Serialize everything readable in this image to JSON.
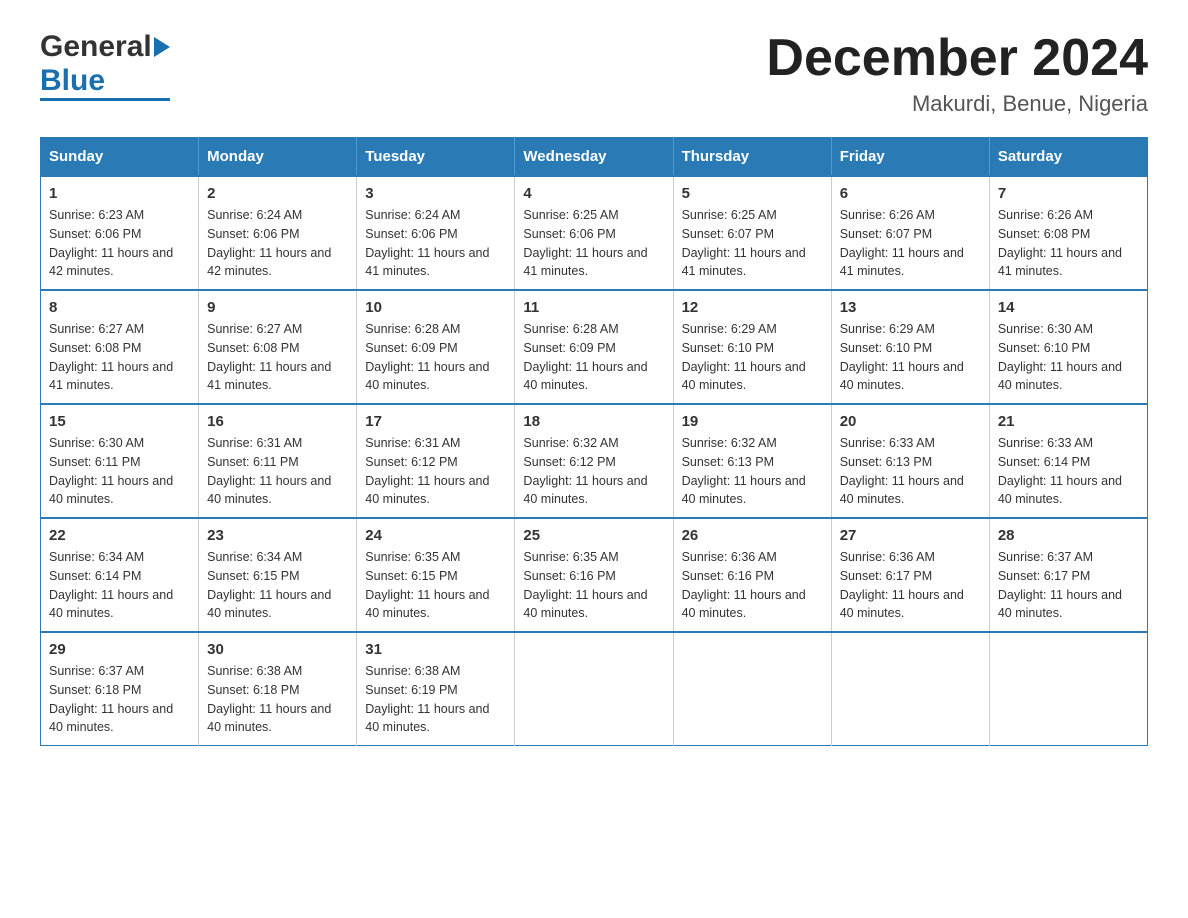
{
  "header": {
    "logo_general": "General",
    "logo_blue": "Blue",
    "main_title": "December 2024",
    "subtitle": "Makurdi, Benue, Nigeria"
  },
  "calendar": {
    "headers": [
      "Sunday",
      "Monday",
      "Tuesday",
      "Wednesday",
      "Thursday",
      "Friday",
      "Saturday"
    ],
    "weeks": [
      [
        {
          "day": "1",
          "sunrise": "6:23 AM",
          "sunset": "6:06 PM",
          "daylight": "11 hours and 42 minutes."
        },
        {
          "day": "2",
          "sunrise": "6:24 AM",
          "sunset": "6:06 PM",
          "daylight": "11 hours and 42 minutes."
        },
        {
          "day": "3",
          "sunrise": "6:24 AM",
          "sunset": "6:06 PM",
          "daylight": "11 hours and 41 minutes."
        },
        {
          "day": "4",
          "sunrise": "6:25 AM",
          "sunset": "6:06 PM",
          "daylight": "11 hours and 41 minutes."
        },
        {
          "day": "5",
          "sunrise": "6:25 AM",
          "sunset": "6:07 PM",
          "daylight": "11 hours and 41 minutes."
        },
        {
          "day": "6",
          "sunrise": "6:26 AM",
          "sunset": "6:07 PM",
          "daylight": "11 hours and 41 minutes."
        },
        {
          "day": "7",
          "sunrise": "6:26 AM",
          "sunset": "6:08 PM",
          "daylight": "11 hours and 41 minutes."
        }
      ],
      [
        {
          "day": "8",
          "sunrise": "6:27 AM",
          "sunset": "6:08 PM",
          "daylight": "11 hours and 41 minutes."
        },
        {
          "day": "9",
          "sunrise": "6:27 AM",
          "sunset": "6:08 PM",
          "daylight": "11 hours and 41 minutes."
        },
        {
          "day": "10",
          "sunrise": "6:28 AM",
          "sunset": "6:09 PM",
          "daylight": "11 hours and 40 minutes."
        },
        {
          "day": "11",
          "sunrise": "6:28 AM",
          "sunset": "6:09 PM",
          "daylight": "11 hours and 40 minutes."
        },
        {
          "day": "12",
          "sunrise": "6:29 AM",
          "sunset": "6:10 PM",
          "daylight": "11 hours and 40 minutes."
        },
        {
          "day": "13",
          "sunrise": "6:29 AM",
          "sunset": "6:10 PM",
          "daylight": "11 hours and 40 minutes."
        },
        {
          "day": "14",
          "sunrise": "6:30 AM",
          "sunset": "6:10 PM",
          "daylight": "11 hours and 40 minutes."
        }
      ],
      [
        {
          "day": "15",
          "sunrise": "6:30 AM",
          "sunset": "6:11 PM",
          "daylight": "11 hours and 40 minutes."
        },
        {
          "day": "16",
          "sunrise": "6:31 AM",
          "sunset": "6:11 PM",
          "daylight": "11 hours and 40 minutes."
        },
        {
          "day": "17",
          "sunrise": "6:31 AM",
          "sunset": "6:12 PM",
          "daylight": "11 hours and 40 minutes."
        },
        {
          "day": "18",
          "sunrise": "6:32 AM",
          "sunset": "6:12 PM",
          "daylight": "11 hours and 40 minutes."
        },
        {
          "day": "19",
          "sunrise": "6:32 AM",
          "sunset": "6:13 PM",
          "daylight": "11 hours and 40 minutes."
        },
        {
          "day": "20",
          "sunrise": "6:33 AM",
          "sunset": "6:13 PM",
          "daylight": "11 hours and 40 minutes."
        },
        {
          "day": "21",
          "sunrise": "6:33 AM",
          "sunset": "6:14 PM",
          "daylight": "11 hours and 40 minutes."
        }
      ],
      [
        {
          "day": "22",
          "sunrise": "6:34 AM",
          "sunset": "6:14 PM",
          "daylight": "11 hours and 40 minutes."
        },
        {
          "day": "23",
          "sunrise": "6:34 AM",
          "sunset": "6:15 PM",
          "daylight": "11 hours and 40 minutes."
        },
        {
          "day": "24",
          "sunrise": "6:35 AM",
          "sunset": "6:15 PM",
          "daylight": "11 hours and 40 minutes."
        },
        {
          "day": "25",
          "sunrise": "6:35 AM",
          "sunset": "6:16 PM",
          "daylight": "11 hours and 40 minutes."
        },
        {
          "day": "26",
          "sunrise": "6:36 AM",
          "sunset": "6:16 PM",
          "daylight": "11 hours and 40 minutes."
        },
        {
          "day": "27",
          "sunrise": "6:36 AM",
          "sunset": "6:17 PM",
          "daylight": "11 hours and 40 minutes."
        },
        {
          "day": "28",
          "sunrise": "6:37 AM",
          "sunset": "6:17 PM",
          "daylight": "11 hours and 40 minutes."
        }
      ],
      [
        {
          "day": "29",
          "sunrise": "6:37 AM",
          "sunset": "6:18 PM",
          "daylight": "11 hours and 40 minutes."
        },
        {
          "day": "30",
          "sunrise": "6:38 AM",
          "sunset": "6:18 PM",
          "daylight": "11 hours and 40 minutes."
        },
        {
          "day": "31",
          "sunrise": "6:38 AM",
          "sunset": "6:19 PM",
          "daylight": "11 hours and 40 minutes."
        },
        null,
        null,
        null,
        null
      ]
    ]
  },
  "colors": {
    "header_bg": "#2a7ab5",
    "header_text": "#ffffff",
    "border": "#2a7ab5",
    "logo_blue": "#1a6faf"
  }
}
